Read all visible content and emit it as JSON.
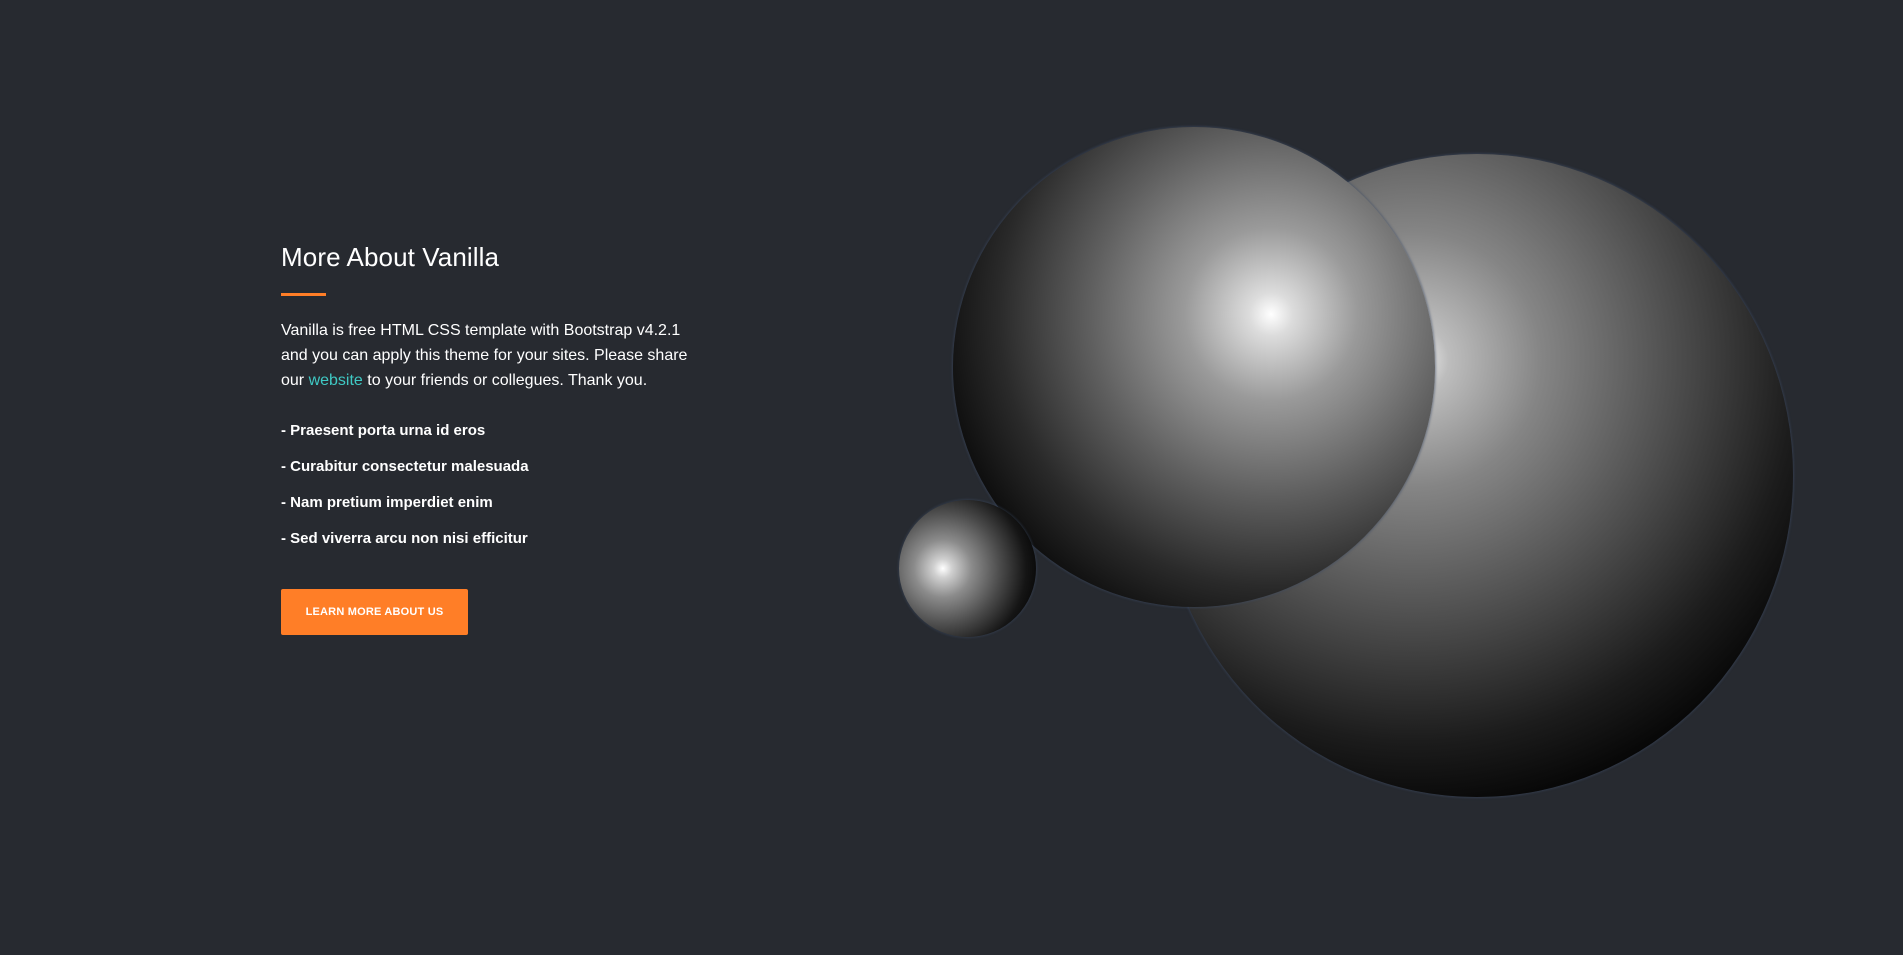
{
  "about": {
    "heading": "More About Vanilla",
    "intro_before_link": "Vanilla is free HTML CSS template with Bootstrap v4.2.1 and you can apply this theme for your sites. Please share our ",
    "link_text": "website",
    "intro_after_link": " to your friends or collegues. Thank you.",
    "features": [
      "- Praesent porta urna id eros",
      "- Curabitur consectetur malesuada",
      "- Nam pretium imperdiet enim",
      "- Sed viverra arcu non nisi efficitur"
    ],
    "button_label": "LEARN MORE ABOUT US"
  },
  "colors": {
    "background": "#272a30",
    "accent": "#ff7e27",
    "link": "#3fc9c4",
    "text": "#ffffff"
  }
}
